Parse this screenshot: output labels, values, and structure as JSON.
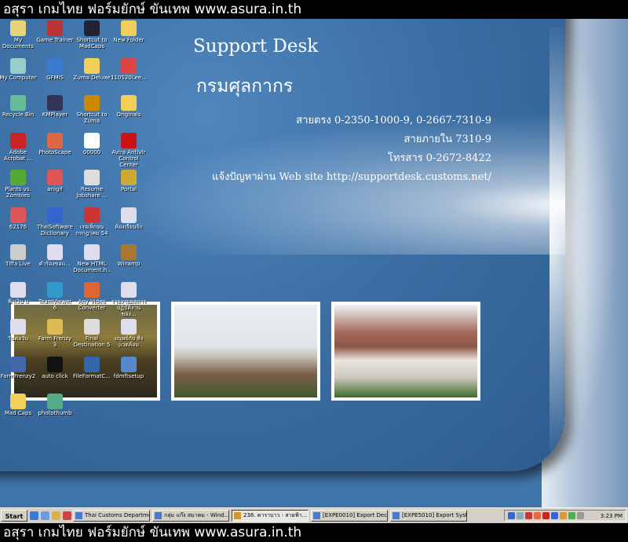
{
  "banner_top": "อสุรา เกมไทย ฟอร์มยักษ์ ขันเทพ www.asura.in.th",
  "banner_bottom": "อสุรา เกมไทย ฟอร์มยักษ์ ขันเทพ www.asura.in.th",
  "wallpaper": {
    "title": "Support Desk",
    "subtitle": "กรมศุลกากร",
    "line1": "สายตรง   0-2350-1000-9, 0-2667-7310-9",
    "line2": "สายภายใน   7310-9",
    "line3": "โทรสาร   0-2672-8422",
    "line4": "แจ้งปัญหาผ่าน Web site http://supportdesk.customs.net/"
  },
  "icons": [
    {
      "label": "My Documents",
      "color": "#e8d27a"
    },
    {
      "label": "Game Trainer",
      "color": "#b33"
    },
    {
      "label": "Shortcut to MadCaps",
      "color": "#223"
    },
    {
      "label": "New Folder",
      "color": "#f2cf5a"
    },
    {
      "label": "My Computer",
      "color": "#9cc"
    },
    {
      "label": "GFMIS",
      "color": "#3a7ad0"
    },
    {
      "label": "Zuma Deluxe",
      "color": "#f2cf5a"
    },
    {
      "label": "110520Lee...",
      "color": "#d44"
    },
    {
      "label": "Recycle Bin",
      "color": "#6b9"
    },
    {
      "label": "KMPlayer",
      "color": "#335"
    },
    {
      "label": "Shortcut to Zuma",
      "color": "#c80"
    },
    {
      "label": "Originals",
      "color": "#f2cf5a"
    },
    {
      "label": "Adobe Acrobat ...",
      "color": "#c22"
    },
    {
      "label": "PhotoScape",
      "color": "#d64"
    },
    {
      "label": "00000",
      "color": "#fff"
    },
    {
      "label": "Avira AntiVir Control Center",
      "color": "#c11"
    },
    {
      "label": "Plants vs. Zombies",
      "color": "#5a3"
    },
    {
      "label": "anigif",
      "color": "#d55"
    },
    {
      "label": "Resume Jobshare ...",
      "color": "#ddd"
    },
    {
      "label": "Portal",
      "color": "#ca3"
    },
    {
      "label": "62176",
      "color": "#d55"
    },
    {
      "label": "ThaiSoftware Dictionary",
      "color": "#36c"
    },
    {
      "label": "เรจเท็กจน กรกฎาคม 54",
      "color": "#c33"
    },
    {
      "label": "ห้องเรียนรัก",
      "color": "#dde"
    },
    {
      "label": "Tiffa Live",
      "color": "#ccc"
    },
    {
      "label": "คำร้องขอเเ...",
      "color": "#dde"
    },
    {
      "label": "New HTML Document.h...",
      "color": "#dde"
    },
    {
      "label": "Winamp",
      "color": "#a73"
    },
    {
      "label": "ฟ้าเงิน บ",
      "color": "#dde"
    },
    {
      "label": "TeamViewer 6",
      "color": "#39c"
    },
    {
      "label": "Any Video Converter",
      "color": "#d63"
    },
    {
      "label": "รายงานผลการ ปฏิบัติงานของ...",
      "color": "#dde"
    },
    {
      "label": "วันต่อวัน",
      "color": "#dde"
    },
    {
      "label": "Farm Frenzy 3",
      "color": "#db5"
    },
    {
      "label": "Final Destination 5",
      "color": "#ddd"
    },
    {
      "label": "มนุษย์กับ สิ่งแวดล้อม",
      "color": "#dde"
    },
    {
      "label": "FarmFrenzy2",
      "color": "#46a"
    },
    {
      "label": "auto click",
      "color": "#111"
    },
    {
      "label": "FileFormatC...",
      "color": "#36a"
    },
    {
      "label": "fdmftsetup",
      "color": "#58c"
    },
    {
      "label": "Mad Caps",
      "color": "#f2cf5a"
    },
    {
      "label": "photothumb",
      "color": "#5a8"
    }
  ],
  "taskbar": {
    "start": "Start",
    "tasks": [
      "Thai Customs Departme...",
      "กลุ่ม แก๊ง สมาคม - Wind...",
      "238. คาราบาว - สายฟ้า...",
      "[EXPE0010] Export Decl...",
      "[EXPE5010] Export Syst..."
    ],
    "clock": "3:23 PM"
  }
}
